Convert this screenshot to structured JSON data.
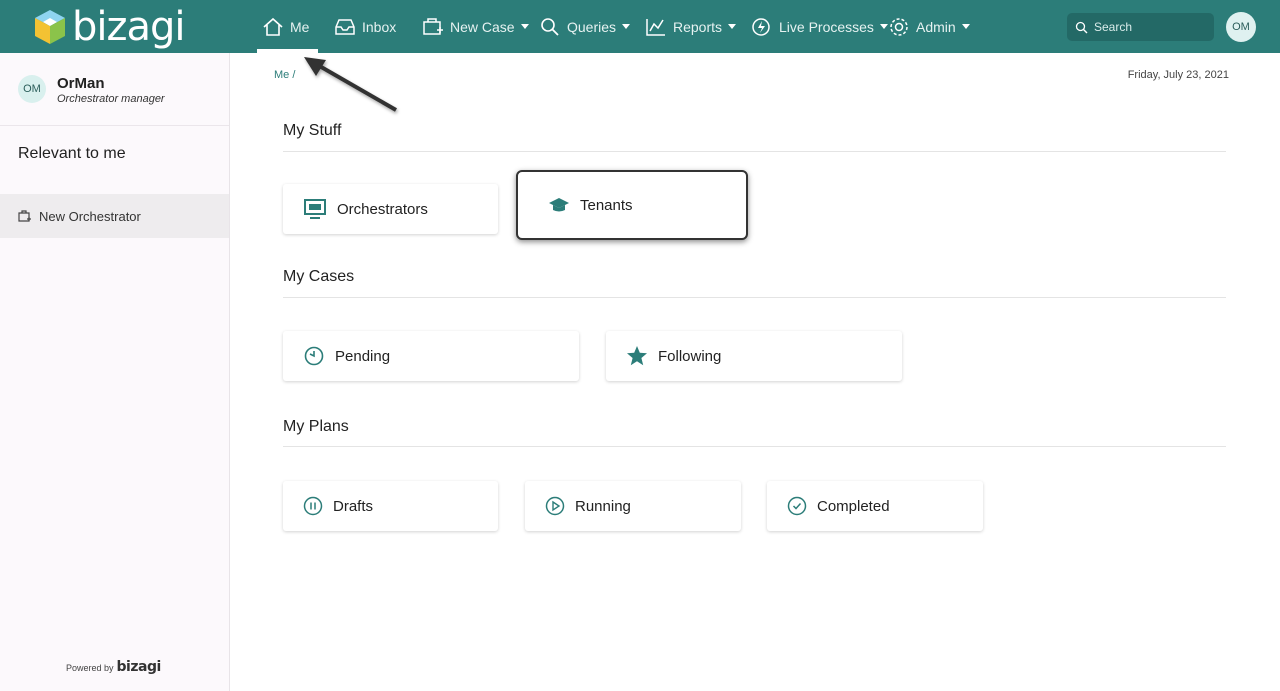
{
  "brand": {
    "name": "bizagi",
    "powered_by": "Powered by",
    "powered_brand": "bizagi"
  },
  "nav": {
    "me": "Me",
    "inbox": "Inbox",
    "new_case": "New Case",
    "queries": "Queries",
    "reports": "Reports",
    "live_processes": "Live Processes",
    "admin": "Admin"
  },
  "search": {
    "placeholder": "Search"
  },
  "user": {
    "initials": "OM",
    "name": "OrMan",
    "role": "Orchestrator manager"
  },
  "sidebar": {
    "heading": "Relevant to me",
    "items": [
      {
        "label": "New Orchestrator"
      }
    ]
  },
  "breadcrumb": "Me /",
  "date": "Friday, July 23, 2021",
  "sections": {
    "my_stuff": {
      "title": "My Stuff",
      "cards": [
        {
          "label": "Orchestrators"
        },
        {
          "label": "Tenants"
        }
      ]
    },
    "my_cases": {
      "title": "My Cases",
      "cards": [
        {
          "label": "Pending"
        },
        {
          "label": "Following"
        }
      ]
    },
    "my_plans": {
      "title": "My Plans",
      "cards": [
        {
          "label": "Drafts"
        },
        {
          "label": "Running"
        },
        {
          "label": "Completed"
        }
      ]
    }
  },
  "colors": {
    "header": "#2c7d79",
    "accent": "#2c7d79",
    "sidebar_bg": "#fcf9fc"
  }
}
